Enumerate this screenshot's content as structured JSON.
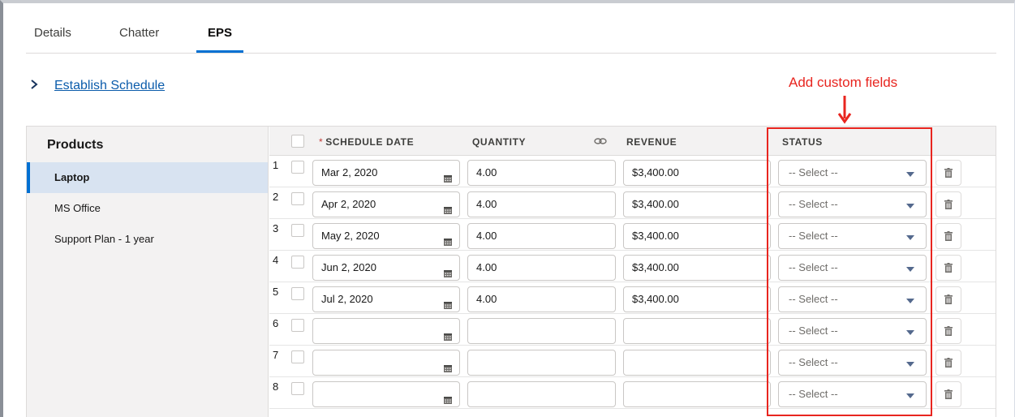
{
  "tabs": [
    {
      "label": "Details"
    },
    {
      "label": "Chatter"
    },
    {
      "label": "EPS"
    }
  ],
  "establish_schedule": {
    "label": "Establish Schedule"
  },
  "annotation": {
    "text": "Add custom fields",
    "color": "#e8251f"
  },
  "sidebar": {
    "title": "Products",
    "items": [
      {
        "label": "Laptop",
        "selected": true
      },
      {
        "label": "MS Office"
      },
      {
        "label": "Support Plan - 1 year"
      }
    ]
  },
  "columns": {
    "required_marker": "*",
    "schedule_date": "SCHEDULE DATE",
    "quantity": "QUANTITY",
    "revenue": "REVENUE",
    "status": "STATUS"
  },
  "rows": [
    {
      "num": "1",
      "date": "Mar 2, 2020",
      "quantity": "4.00",
      "revenue": "$3,400.00",
      "status": "-- Select --"
    },
    {
      "num": "2",
      "date": "Apr 2, 2020",
      "quantity": "4.00",
      "revenue": "$3,400.00",
      "status": "-- Select --"
    },
    {
      "num": "3",
      "date": "May 2, 2020",
      "quantity": "4.00",
      "revenue": "$3,400.00",
      "status": "-- Select --"
    },
    {
      "num": "4",
      "date": "Jun 2, 2020",
      "quantity": "4.00",
      "revenue": "$3,400.00",
      "status": "-- Select --"
    },
    {
      "num": "5",
      "date": "Jul 2, 2020",
      "quantity": "4.00",
      "revenue": "$3,400.00",
      "status": "-- Select --"
    },
    {
      "num": "6",
      "date": "",
      "quantity": "",
      "revenue": "",
      "status": "-- Select --"
    },
    {
      "num": "7",
      "date": "",
      "quantity": "",
      "revenue": "",
      "status": "-- Select --"
    },
    {
      "num": "8",
      "date": "",
      "quantity": "",
      "revenue": "",
      "status": "-- Select --"
    }
  ],
  "colors": {
    "accent": "#0070d2",
    "annotation_red": "#e8251f"
  }
}
